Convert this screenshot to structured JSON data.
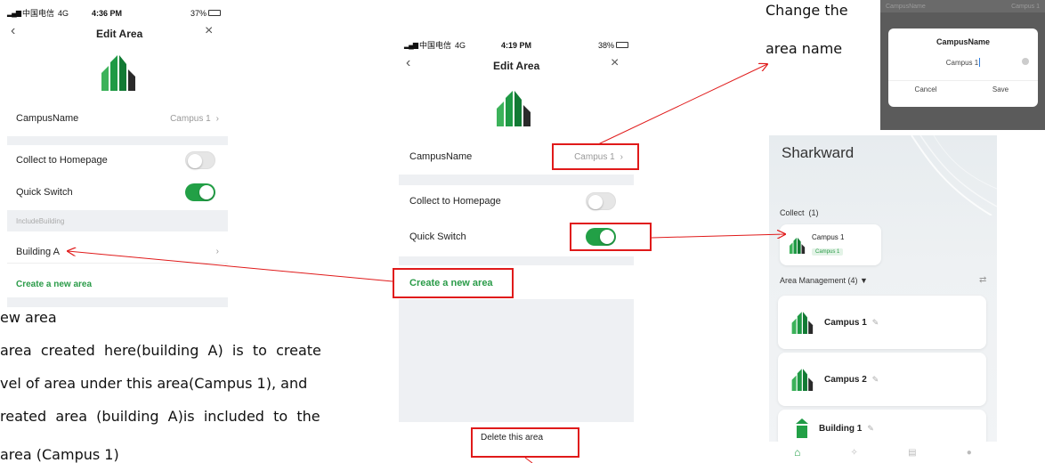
{
  "left_screen": {
    "status": {
      "carrier": "中国电信",
      "network": "4G",
      "time": "4:36 PM",
      "battery": "37%"
    },
    "nav": {
      "title": "Edit Area"
    },
    "rows": {
      "campus_label": "CampusName",
      "campus_value": "Campus 1",
      "collect_label": "Collect to Homepage",
      "collect_on": false,
      "quick_label": "Quick Switch",
      "quick_on": true,
      "section_header": "IncludeBuilding",
      "building_label": "Building A",
      "create_label": "Create a new area"
    }
  },
  "middle_screen": {
    "status": {
      "carrier": "中国电信",
      "network": "4G",
      "time": "4:19 PM",
      "battery": "38%"
    },
    "nav": {
      "title": "Edit Area"
    },
    "rows": {
      "campus_label": "CampusName",
      "campus_value": "Campus 1",
      "collect_label": "Collect to Homepage",
      "collect_on": false,
      "quick_label": "Quick Switch",
      "quick_on": true,
      "create_label": "Create a new area",
      "delete_label": "Delete this area"
    }
  },
  "dialog": {
    "bg_label": "CampusName",
    "bg_value": "Campus 1",
    "title": "CampusName",
    "input_value": "Campus 1",
    "cancel": "Cancel",
    "save": "Save"
  },
  "right_screen": {
    "app_title": "Sharkward",
    "collect_header": "Collect  (1)",
    "collect_card": {
      "name": "Campus 1",
      "tag": "Campus 1"
    },
    "area_header": "Area Management (4) ▼",
    "areas": [
      "Campus 1",
      "Campus 2",
      "Building 1"
    ]
  },
  "annotations": {
    "change_name_line1": "Change the",
    "change_name_line2": "area name",
    "new_area_heading": "ew area",
    "desc_line1": "area  created  here(building  A)  is  to  create",
    "desc_line2": "vel of area under this area(Campus 1), and",
    "desc_line3": "reated  area  (building  A)is  included  to  the",
    "desc_line4": "area (Campus 1)"
  },
  "colors": {
    "accent_green": "#22a046",
    "annotation_red": "#e01a1a",
    "gap_gray": "#eef0f3"
  }
}
